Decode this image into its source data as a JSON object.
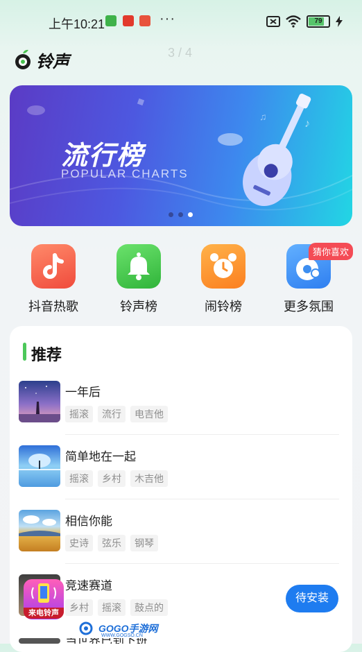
{
  "status_bar": {
    "time": "上午10:21",
    "more": "···",
    "battery": "79"
  },
  "header": {
    "app_name": "铃声",
    "pager": "3 / 4"
  },
  "banner": {
    "title": "流行榜",
    "subtitle": "POPULAR CHARTS",
    "active_dot": 2
  },
  "categories": [
    {
      "label": "抖音热歌",
      "icon": "tiktok-icon",
      "color": "#f3614f"
    },
    {
      "label": "铃声榜",
      "icon": "bell-icon",
      "color": "#3fc548"
    },
    {
      "label": "闹铃榜",
      "icon": "alarm-clock-icon",
      "color": "#fb8f2c"
    },
    {
      "label": "更多氛围",
      "icon": "disc-icon",
      "color": "#3d8ef0",
      "badge": "猜你喜欢"
    }
  ],
  "recommend": {
    "title": "推荐",
    "songs": [
      {
        "title": "一年后",
        "tags": [
          "摇滚",
          "流行",
          "电吉他"
        ]
      },
      {
        "title": "简单地在一起",
        "tags": [
          "摇滚",
          "乡村",
          "木吉他"
        ]
      },
      {
        "title": "相信你能",
        "tags": [
          "史诗",
          "弦乐",
          "钢琴"
        ]
      },
      {
        "title": "竞速赛道",
        "tags": [
          "乡村",
          "摇滚",
          "鼓点的"
        ]
      },
      {
        "title": "当世界已到下班",
        "tags": []
      }
    ],
    "install_label": "待安装"
  },
  "floating_app": {
    "label": "来电铃声"
  },
  "watermark": {
    "text": "GOGO手游网",
    "sub": "WWW.GOGSO.CN"
  }
}
